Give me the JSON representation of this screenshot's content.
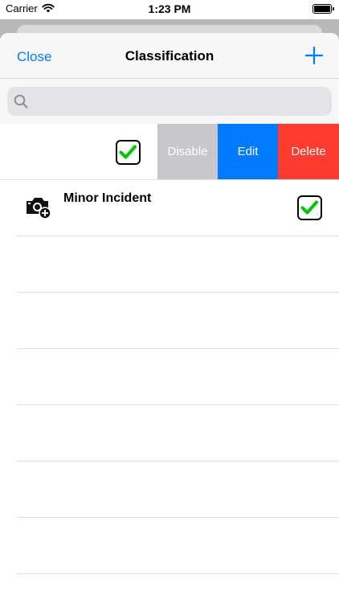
{
  "status_bar": {
    "carrier": "Carrier",
    "time": "1:23 PM"
  },
  "nav": {
    "close_label": "Close",
    "title": "Classification"
  },
  "search": {
    "placeholder": "",
    "value": ""
  },
  "rows": [
    {
      "title": "",
      "checked": true,
      "swipe_actions": [
        "Disable",
        "Edit",
        "Delete"
      ]
    },
    {
      "title": "Minor Incident",
      "icon": "camera-add-icon",
      "checked": true
    }
  ],
  "colors": {
    "accent": "#007aff",
    "disable": "#c7c7cc",
    "edit": "#007aff",
    "delete": "#ff3b30",
    "check": "#00c800"
  }
}
